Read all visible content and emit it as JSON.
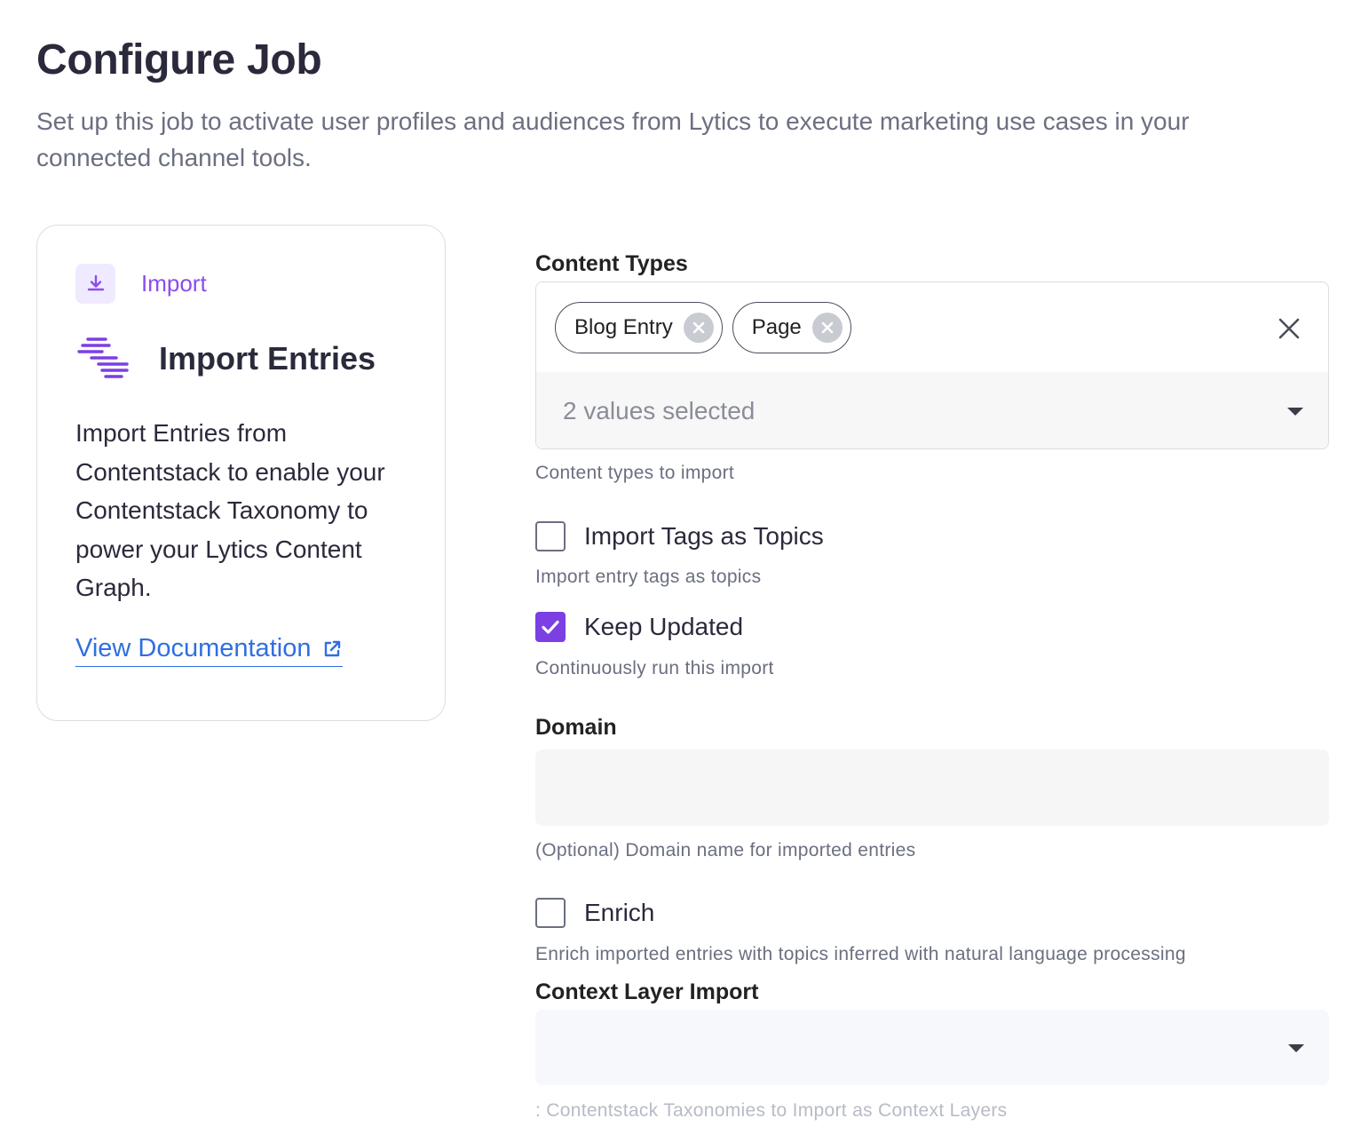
{
  "header": {
    "title": "Configure Job",
    "subtitle": "Set up this job to activate user profiles and audiences from Lytics to execute marketing use cases in your connected channel tools."
  },
  "card": {
    "category_icon": "download-icon",
    "category_label": "Import",
    "job_icon": "stacked-lines-icon",
    "job_title": "Import Entries",
    "description": "Import Entries from Contentstack to enable your Contentstack Taxonomy to power your Lytics Content Graph.",
    "doc_link_label": "View Documentation",
    "doc_link_icon": "external-link-icon"
  },
  "form": {
    "content_types": {
      "label": "Content Types",
      "chips": [
        "Blog Entry",
        "Page"
      ],
      "selected_summary": "2 values selected",
      "help": "Content types to import"
    },
    "import_tags": {
      "label": "Import Tags as Topics",
      "checked": false,
      "help": "Import entry tags as topics"
    },
    "keep_updated": {
      "label": "Keep Updated",
      "checked": true,
      "help": "Continuously run this import"
    },
    "domain": {
      "label": "Domain",
      "value": "",
      "help": "(Optional) Domain name for imported entries"
    },
    "enrich": {
      "label": "Enrich",
      "checked": false,
      "help": "Enrich imported entries with topics inferred with natural language processing"
    },
    "context_layer": {
      "label": "Context Layer Import",
      "value": "",
      "help": ": Contentstack Taxonomies to Import as Context Layers"
    }
  },
  "colors": {
    "accent": "#7b3fe4",
    "link": "#2f6fe0",
    "title": "#2a2a3c",
    "muted": "#6b6f80"
  }
}
